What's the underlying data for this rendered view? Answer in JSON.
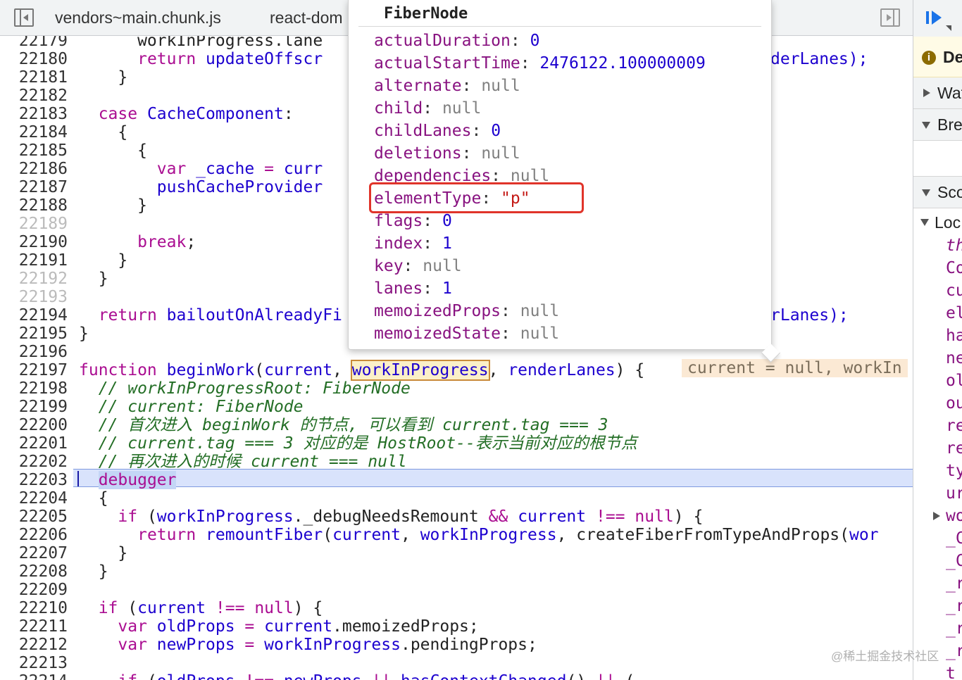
{
  "tabs": [
    {
      "label": "vendors~main.chunk.js"
    },
    {
      "label": "react-dom"
    }
  ],
  "code_lines": [
    {
      "num": "22179",
      "dim": false,
      "segs": [
        {
          "t": "      workInProgress.lane"
        }
      ]
    },
    {
      "num": "22180",
      "dim": false,
      "segs": [
        {
          "t": "      ",
          "c": ""
        },
        {
          "t": "return ",
          "c": "kw"
        },
        {
          "t": "updateOffscr",
          "c": "fn"
        }
      ]
    },
    {
      "num": "22181",
      "dim": false,
      "segs": [
        {
          "t": "    }"
        }
      ]
    },
    {
      "num": "22182",
      "dim": false,
      "segs": [
        {
          "t": ""
        }
      ]
    },
    {
      "num": "22183",
      "dim": false,
      "segs": [
        {
          "t": "  "
        },
        {
          "t": "case ",
          "c": "kw"
        },
        {
          "t": "CacheComponent",
          "c": "fn"
        },
        {
          "t": ":"
        }
      ]
    },
    {
      "num": "22184",
      "dim": false,
      "segs": [
        {
          "t": "    {"
        }
      ]
    },
    {
      "num": "22185",
      "dim": false,
      "segs": [
        {
          "t": "      {"
        }
      ]
    },
    {
      "num": "22186",
      "dim": false,
      "segs": [
        {
          "t": "        "
        },
        {
          "t": "var ",
          "c": "kw"
        },
        {
          "t": "_cache",
          "c": "fn"
        },
        {
          "t": " = ",
          "c": "kw"
        },
        {
          "t": "curr",
          "c": "fn"
        }
      ]
    },
    {
      "num": "22187",
      "dim": false,
      "segs": [
        {
          "t": "        "
        },
        {
          "t": "pushCacheProvider",
          "c": "fn"
        }
      ]
    },
    {
      "num": "22188",
      "dim": false,
      "segs": [
        {
          "t": "      }"
        }
      ]
    },
    {
      "num": "22189",
      "dim": true,
      "segs": [
        {
          "t": ""
        }
      ]
    },
    {
      "num": "22190",
      "dim": false,
      "segs": [
        {
          "t": "      "
        },
        {
          "t": "break",
          "c": "kw"
        },
        {
          "t": ";"
        }
      ]
    },
    {
      "num": "22191",
      "dim": false,
      "segs": [
        {
          "t": "    }"
        }
      ]
    },
    {
      "num": "22192",
      "dim": true,
      "segs": [
        {
          "t": "  }"
        }
      ]
    },
    {
      "num": "22193",
      "dim": true,
      "segs": [
        {
          "t": ""
        }
      ]
    },
    {
      "num": "22194",
      "dim": false,
      "segs": [
        {
          "t": "  "
        },
        {
          "t": "return ",
          "c": "kw"
        },
        {
          "t": "bailoutOnAlreadyFi",
          "c": "fn"
        }
      ]
    },
    {
      "num": "22195",
      "dim": false,
      "segs": [
        {
          "t": "}"
        }
      ]
    },
    {
      "num": "22196",
      "dim": false,
      "segs": [
        {
          "t": ""
        }
      ]
    },
    {
      "num": "22197",
      "dim": false,
      "segs": [
        {
          "t": "function ",
          "c": "kw"
        },
        {
          "t": "beginWork",
          "c": "fn"
        },
        {
          "t": "("
        },
        {
          "t": "current",
          "c": "fn"
        },
        {
          "t": ", "
        },
        {
          "t": "workInProgress",
          "c": "fn ref-box"
        },
        {
          "t": ", "
        },
        {
          "t": "renderLanes",
          "c": "fn"
        },
        {
          "t": ") {"
        }
      ]
    },
    {
      "num": "22198",
      "dim": false,
      "segs": [
        {
          "t": "  // workInProgressRoot: FiberNode",
          "c": "cm"
        }
      ]
    },
    {
      "num": "22199",
      "dim": false,
      "segs": [
        {
          "t": "  // current: FiberNode",
          "c": "cm"
        }
      ]
    },
    {
      "num": "22200",
      "dim": false,
      "segs": [
        {
          "t": "  // 首次进入 beginWork 的节点, 可以看到 current.tag === 3",
          "c": "cm"
        }
      ]
    },
    {
      "num": "22201",
      "dim": false,
      "segs": [
        {
          "t": "  // current.tag === 3 对应的是 HostRoot--表示当前对应的根节点",
          "c": "cm"
        }
      ]
    },
    {
      "num": "22202",
      "dim": false,
      "segs": [
        {
          "t": "  // 再次进入的时候 current === null",
          "c": "cm"
        }
      ]
    },
    {
      "num": "22203",
      "dim": false,
      "segs": [
        {
          "t": "  "
        },
        {
          "t": "debugger",
          "c": "kw hl-word"
        }
      ]
    },
    {
      "num": "22204",
      "dim": false,
      "segs": [
        {
          "t": "  {"
        }
      ]
    },
    {
      "num": "22205",
      "dim": false,
      "segs": [
        {
          "t": "    "
        },
        {
          "t": "if ",
          "c": "kw"
        },
        {
          "t": "("
        },
        {
          "t": "workInProgress",
          "c": "fn"
        },
        {
          "t": "._debugNeedsRemount "
        },
        {
          "t": "&&",
          "c": "kw"
        },
        {
          "t": " "
        },
        {
          "t": "current",
          "c": "fn"
        },
        {
          "t": " "
        },
        {
          "t": "!==",
          "c": "kw"
        },
        {
          "t": " "
        },
        {
          "t": "null",
          "c": "kw"
        },
        {
          "t": ") {"
        }
      ]
    },
    {
      "num": "22206",
      "dim": false,
      "segs": [
        {
          "t": "      "
        },
        {
          "t": "return ",
          "c": "kw"
        },
        {
          "t": "remountFiber",
          "c": "fn"
        },
        {
          "t": "("
        },
        {
          "t": "current",
          "c": "fn"
        },
        {
          "t": ", "
        },
        {
          "t": "workInProgress",
          "c": "fn"
        },
        {
          "t": ", createFiberFromTypeAndProps("
        },
        {
          "t": "wor",
          "c": "fn"
        }
      ]
    },
    {
      "num": "22207",
      "dim": false,
      "segs": [
        {
          "t": "    }"
        }
      ]
    },
    {
      "num": "22208",
      "dim": false,
      "segs": [
        {
          "t": "  }"
        }
      ]
    },
    {
      "num": "22209",
      "dim": false,
      "segs": [
        {
          "t": ""
        }
      ]
    },
    {
      "num": "22210",
      "dim": false,
      "segs": [
        {
          "t": "  "
        },
        {
          "t": "if ",
          "c": "kw"
        },
        {
          "t": "("
        },
        {
          "t": "current",
          "c": "fn"
        },
        {
          "t": " "
        },
        {
          "t": "!==",
          "c": "kw"
        },
        {
          "t": " "
        },
        {
          "t": "null",
          "c": "kw"
        },
        {
          "t": ") {"
        }
      ]
    },
    {
      "num": "22211",
      "dim": false,
      "segs": [
        {
          "t": "    "
        },
        {
          "t": "var ",
          "c": "kw"
        },
        {
          "t": "oldProps",
          "c": "fn"
        },
        {
          "t": " = ",
          "c": "kw"
        },
        {
          "t": "current",
          "c": "fn"
        },
        {
          "t": ".memoizedProps;"
        }
      ]
    },
    {
      "num": "22212",
      "dim": false,
      "segs": [
        {
          "t": "    "
        },
        {
          "t": "var ",
          "c": "kw"
        },
        {
          "t": "newProps",
          "c": "fn"
        },
        {
          "t": " = ",
          "c": "kw"
        },
        {
          "t": "workInProgress",
          "c": "fn"
        },
        {
          "t": ".pendingProps;"
        }
      ]
    },
    {
      "num": "22213",
      "dim": false,
      "segs": [
        {
          "t": ""
        }
      ]
    },
    {
      "num": "22214",
      "dim": false,
      "segs": [
        {
          "t": "    "
        },
        {
          "t": "if ",
          "c": "kw"
        },
        {
          "t": "("
        },
        {
          "t": "oldProps",
          "c": "fn"
        },
        {
          "t": " "
        },
        {
          "t": "!==",
          "c": "kw"
        },
        {
          "t": " "
        },
        {
          "t": "newProps",
          "c": "fn"
        },
        {
          "t": " "
        },
        {
          "t": "||",
          "c": "kw"
        },
        {
          "t": " "
        },
        {
          "t": "hasContextChanged",
          "c": "fn"
        },
        {
          "t": "() "
        },
        {
          "t": "||",
          "c": "kw"
        },
        {
          "t": " ("
        }
      ]
    }
  ],
  "right_fragments": [
    {
      "line_index": 1,
      "text": "derLanes);"
    },
    {
      "line_index": 15,
      "text": "rLanes);"
    }
  ],
  "inline_value": "current = null, workIn",
  "tooltip": {
    "title": "FiberNode",
    "props": [
      {
        "key": "actualDuration",
        "value": "0",
        "type": "num"
      },
      {
        "key": "actualStartTime",
        "value": "2476122.100000009",
        "type": "num"
      },
      {
        "key": "alternate",
        "value": "null",
        "type": "null"
      },
      {
        "key": "child",
        "value": "null",
        "type": "null"
      },
      {
        "key": "childLanes",
        "value": "0",
        "type": "num"
      },
      {
        "key": "deletions",
        "value": "null",
        "type": "null"
      },
      {
        "key": "dependencies",
        "value": "null",
        "type": "null"
      },
      {
        "key": "elementType",
        "value": "\"p\"",
        "type": "str"
      },
      {
        "key": "flags",
        "value": "0",
        "type": "num"
      },
      {
        "key": "index",
        "value": "1",
        "type": "num"
      },
      {
        "key": "key",
        "value": "null",
        "type": "null"
      },
      {
        "key": "lanes",
        "value": "1",
        "type": "num"
      },
      {
        "key": "memoizedProps",
        "value": "null",
        "type": "null"
      },
      {
        "key": "memoizedState",
        "value": "null",
        "type": "null"
      }
    ],
    "highlighted_key": "elementType"
  },
  "sidebar": {
    "paused_label": "De",
    "watch_label": "Wat",
    "breakpoints_label": "Bre",
    "scope_label": "Sco",
    "local_label": "Loc",
    "scope_items": [
      "th",
      "Co",
      "cu",
      "el",
      "ha",
      "ne",
      "ol",
      "ou",
      "re",
      "re",
      "ty",
      "ur",
      "wo",
      "_C",
      "_C",
      "_r",
      "_r",
      "_r",
      "_r",
      "t"
    ]
  },
  "watermark": "@稀土掘金技术社区"
}
